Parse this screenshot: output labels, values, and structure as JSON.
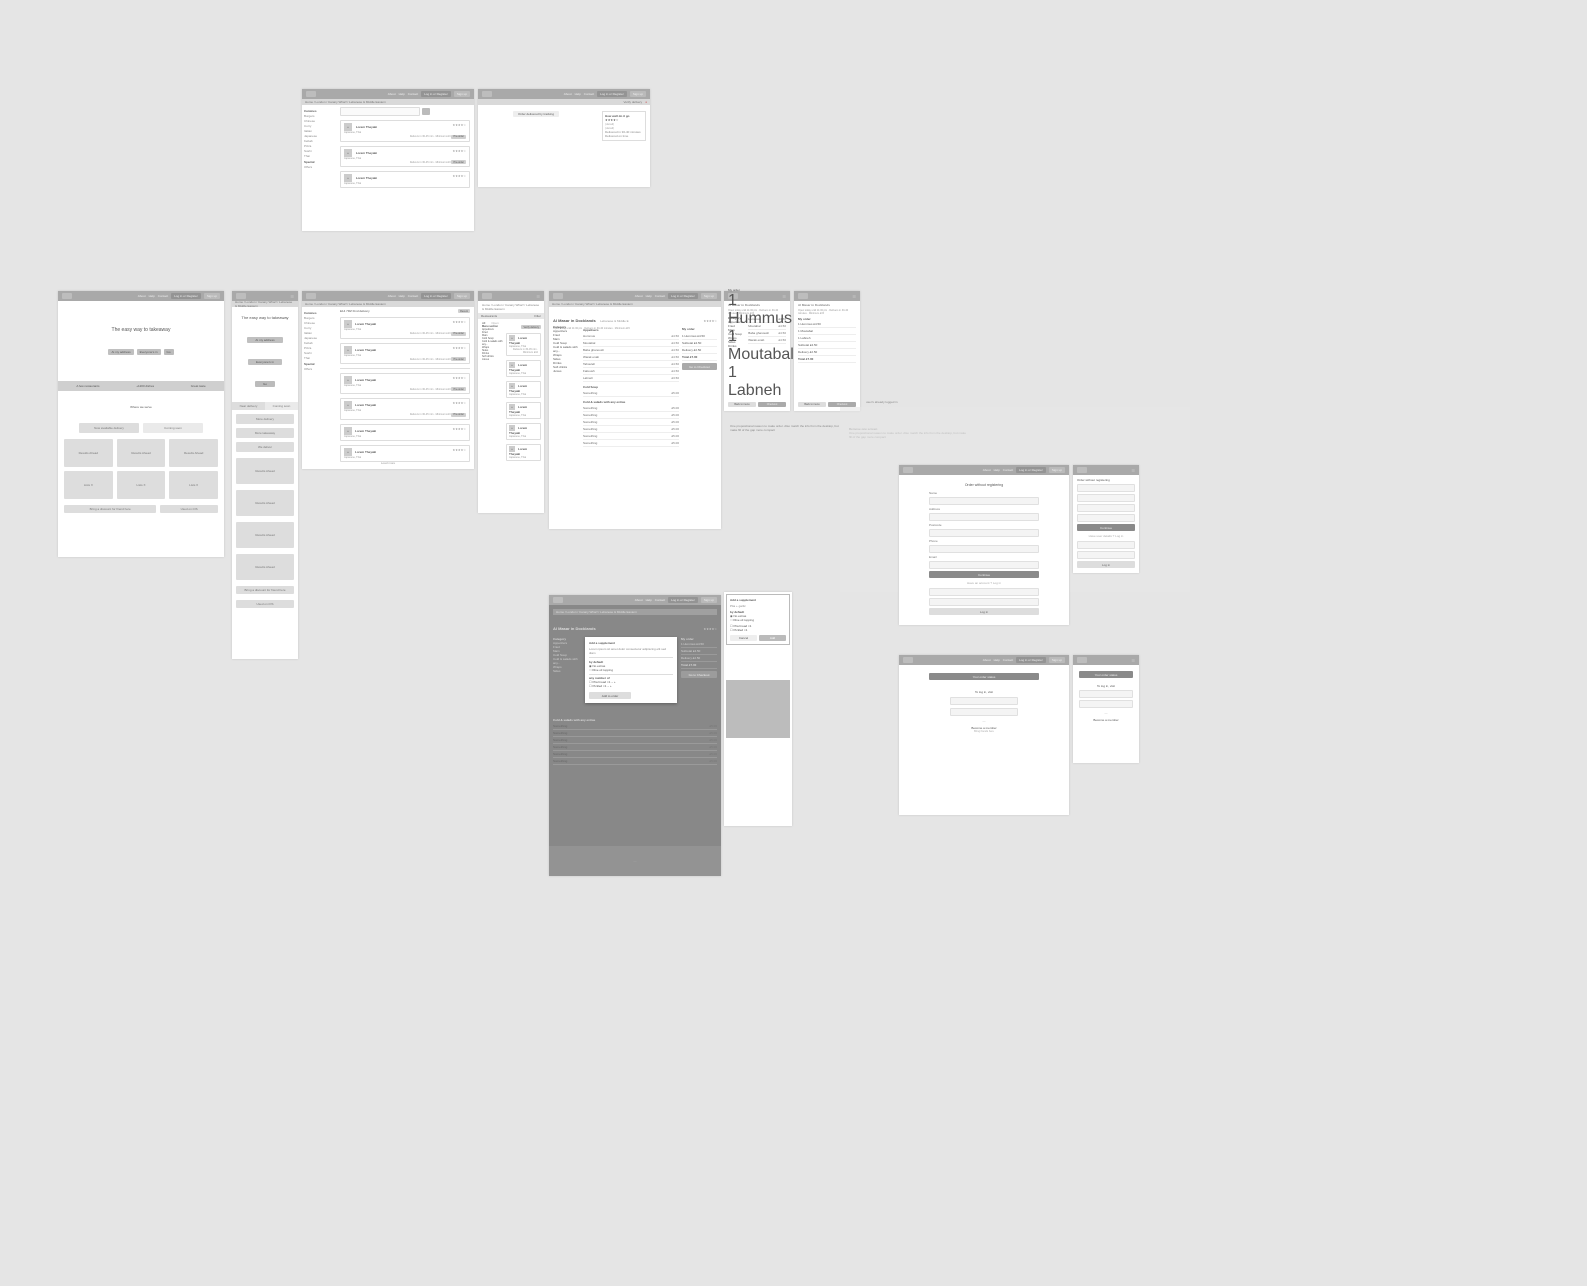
{
  "common": {
    "nav": [
      "About",
      "Help",
      "Contact"
    ],
    "login": "Log in or Register",
    "partner": "Sign up",
    "logo": "deliveroo"
  },
  "row1": {
    "breadcrumb": "Home / London / Canary Wharf / Lebanese & Middle Eastern",
    "bar_right": "Verify delivery location",
    "sidebar": {
      "h1": "Cuisines",
      "items1": [
        "Burgers",
        "Chinese",
        "Curry",
        "Italian",
        "Japanese",
        "Kebab",
        "Pizza",
        "Sushi",
        "Thai"
      ],
      "h2": "Special",
      "items2": [
        "Offers"
      ]
    },
    "list": [
      {
        "name": "Lorem Theyaki",
        "sub": "Japanese, Thai",
        "sub2": "Delivers in 30-45 min · Minimum £10"
      },
      {
        "name": "Lorem Theyaki",
        "sub": "Japanese, Thai",
        "sub2": "Delivers in 30-45 min · Minimum £10"
      },
      {
        "name": "Lorem Theyaki",
        "sub": "Japanese, Thai",
        "sub2": "Delivers in 30-45 min · Minimum £10"
      }
    ],
    "preorder": "Pre-order",
    "stars": "★★★★☆"
  },
  "row1b": {
    "bar": "Order delivered by tracking",
    "bar_r": "Verify delivery",
    "panel": {
      "title": "How well do it go",
      "items": [
        "★★★★☆",
        "(detail)",
        "(detail)",
        "Delivered in 30-40 minutes",
        "Delivered on time"
      ]
    }
  },
  "home": {
    "hero": "The easy way to takeaway",
    "btn1": "At my address",
    "btn2": "Everyone's in",
    "btn3": "Go",
    "strip": [
      "A few restaurants",
      "+1200 dishes",
      "Great taste"
    ],
    "serve": "Where we serve",
    "tab1": "Now available delivery",
    "tab2": "Coming soon",
    "cards": [
      "Results Ahead",
      "Results Ahead",
      "Results Ahead",
      "Lists X",
      "Lists X",
      "Lists X"
    ],
    "footl": "Bring a discount for friend here",
    "footr": "Used on iOS"
  },
  "mobhome": {
    "hero": "The easy way to takeaway",
    "btn1": "At my address",
    "btn2": "Everyone's in",
    "btn3": "Go",
    "tab1": "Near delivery",
    "tab2": "Coming soon",
    "sec1": "More delivery",
    "sec2": "More takeaway",
    "sec3": "We deliver",
    "card": "Results Ahead",
    "footl": "Bring a discount for friend here",
    "footr": "Used on iOS"
  },
  "listD": {
    "title": "E14 7RZ Find delivery",
    "btn": "Recent",
    "load": "Load more",
    "sidebar": {
      "h1": "Cuisines",
      "items1": [
        "Burgers",
        "Chinese",
        "Curry",
        "Italian",
        "Japanese",
        "Kebab",
        "Pizza",
        "Sushi",
        "Thai"
      ],
      "h2": "Special",
      "items2": [
        "Offers"
      ]
    }
  },
  "listE": {
    "top": "Restaurants",
    "right": "Filter",
    "tab1": "All",
    "tab2": "Open",
    "sidehead": "Menu section",
    "sideitems": [
      "Appetizers",
      "Fried",
      "Main",
      "Cold Soup",
      "Cold & salads with any...",
      "Wraps",
      "Sides",
      "Drinks",
      "Soft drinks",
      "Juices"
    ]
  },
  "menuF": {
    "name": "Al Masar in Docklands",
    "cuisine": "Lebanese & Middle E",
    "meta": "Open today until 11:00 pm · Delivers in 30-40 minutes · Minimum £15",
    "catshdr": "Category",
    "cats": [
      "Appetizers",
      "Fried",
      "Main",
      "Cold Soup",
      "Cold & salads with any...",
      "Wraps",
      "Sides",
      "Drinks",
      "Soft drinks",
      "Juices"
    ],
    "sec1": "Appetisers",
    "sec1items": [
      {
        "n": "Hummus",
        "p": "£4.50"
      },
      {
        "n": "Moutabal",
        "p": "£4.50"
      },
      {
        "n": "Baba ghanoush",
        "p": "£4.50"
      },
      {
        "n": "Warak enab",
        "p": "£4.50"
      },
      {
        "n": "Tabouleh",
        "p": "£4.50"
      },
      {
        "n": "Fattoush",
        "p": "£4.50"
      },
      {
        "n": "Labneh",
        "p": "£3.50"
      }
    ],
    "sec2": "Cold Soup",
    "sec2items": [
      {
        "n": "Something",
        "p": "£5.00"
      }
    ],
    "sec3": "Cold & salads with any extras",
    "sec3items": [
      {
        "n": "Something",
        "p": "£5.00"
      },
      {
        "n": "Something",
        "p": "£5.00"
      },
      {
        "n": "Something",
        "p": "£5.00"
      },
      {
        "n": "Something",
        "p": "£5.00"
      },
      {
        "n": "Something",
        "p": "£5.00"
      },
      {
        "n": "Something",
        "p": "£5.00"
      }
    ]
  },
  "cartF": {
    "title": "My order",
    "line": "1 Hummus £4.50",
    "sub": "Subtotal £4.50",
    "del": "Delivery £2.50",
    "tot": "Total £7.00",
    "b1": "Go to Checkout"
  },
  "menuG": {
    "name": "Al Masar in Docklands",
    "cat": "Category",
    "cats": [
      "Appetizers",
      "Fried",
      "Main",
      "Cold Soup",
      "Wraps",
      "Sides",
      "Drinks"
    ],
    "order": "My order",
    "lines": [
      "1 Hummus",
      "1 Moutabal",
      "1 Labneh"
    ],
    "b1": "Back to menu",
    "b2": "Checkout"
  },
  "annot1": "user's already logged in",
  "annot2_h": "Remove one screen",
  "annot2_b": "One propositional reason to make order. Also match the info from the desktop, but make fill of the gap more compact",
  "checkoutD": {
    "title": "Order without registering",
    "fields": [
      "Name",
      "Address",
      "Postcode",
      "City",
      "Phone",
      "Email"
    ],
    "btn": "Continue",
    "or": "Have an account ? Log in",
    "login_e": "Email",
    "login_p": "Password",
    "login_b": "Log in"
  },
  "checkoutM": {
    "title": "Order without registering",
    "btn": "Continue",
    "sec2": "Have user details ? Log in",
    "b2": "Log in"
  },
  "confirmD": {
    "bar": "Your order status",
    "step": "To log in, visit",
    "link": "Become a member",
    "sub": "Bring friends here"
  },
  "confirmM": {
    "bar": "Your order status",
    "step": "To log in, visit",
    "link": "Become a member"
  },
  "popF": {
    "name": "Al Masar in Docklands",
    "modal_t": "Add a supplement",
    "modal_copy": "Lorem ipsum sit amet dolor consectetur adipiscing elit sed diam",
    "opt_h": "by default",
    "opts": [
      "No extras",
      "Olive oil topping"
    ],
    "qty_h": "any number of",
    "qtys": [
      "Pita bread ×1",
      "Pickled ×1"
    ],
    "add": "Add to order"
  },
  "popG": {
    "title": "Add a supplement",
    "copy": "Pita + garlic",
    "opt_h": "by default",
    "opts": [
      "No extras",
      "Olive oil topping"
    ],
    "qtys": [
      "Pita bread ×1",
      "Pickled ×1"
    ],
    "b1": "Cancel",
    "b2": "Add"
  }
}
